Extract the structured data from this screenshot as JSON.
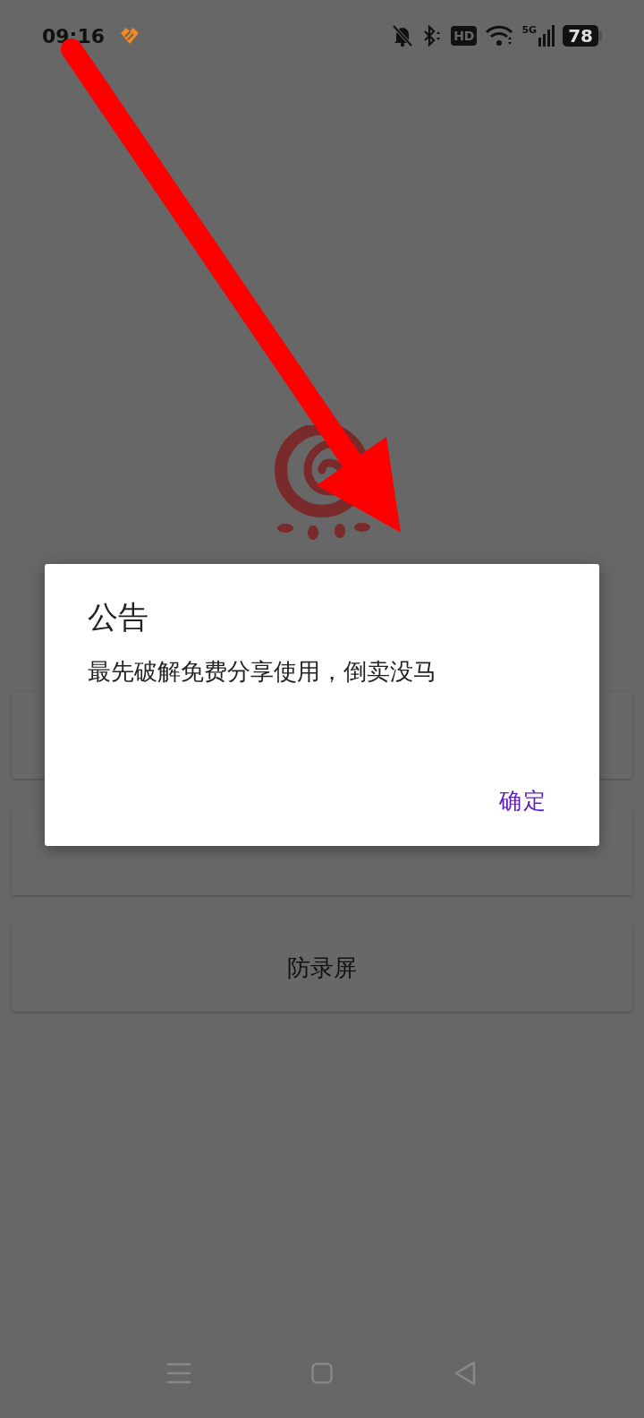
{
  "status_bar": {
    "time": "09:16",
    "hd_badge": "HD",
    "network": "5G",
    "battery": "78"
  },
  "buttons": [
    {
      "kind": "blank"
    },
    {
      "kind": "blank"
    },
    {
      "kind": "labeled",
      "label": "防录屏"
    }
  ],
  "dialog": {
    "title": "公告",
    "message": "最先破解免费分享使用，倒卖没马",
    "confirm": "确定"
  }
}
